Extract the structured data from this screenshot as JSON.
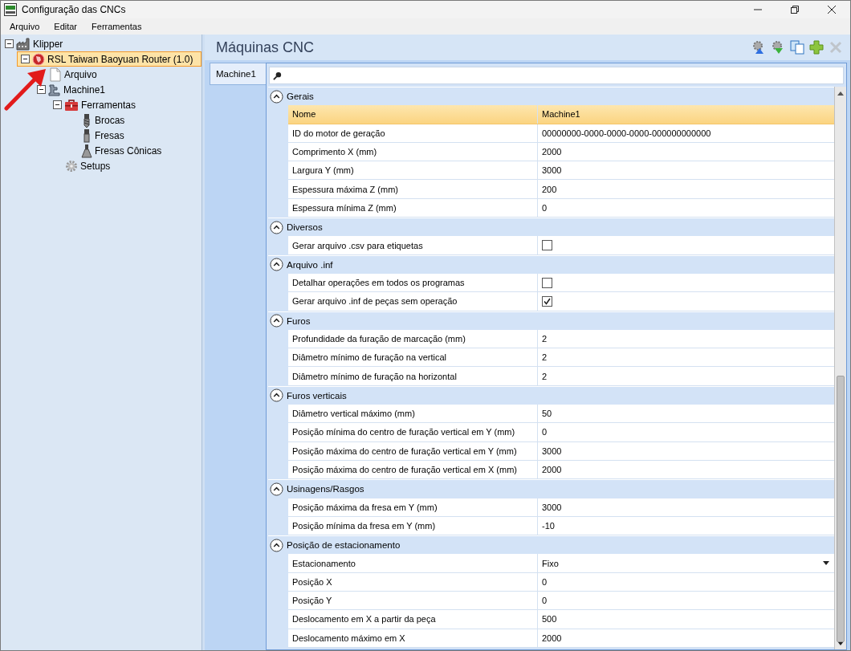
{
  "window": {
    "title": "Configuração das CNCs"
  },
  "menu": [
    {
      "label": "Arquivo"
    },
    {
      "label": "Editar"
    },
    {
      "label": "Ferramentas"
    }
  ],
  "tree": [
    {
      "label": "Klipper",
      "kind": "factory",
      "expanded": true,
      "selected": false,
      "children": [
        {
          "label": "RSL Taiwan Baoyuan Router (1.0)",
          "kind": "router",
          "expanded": true,
          "selected": true,
          "children": [
            {
              "label": "Arquivo",
              "kind": "file",
              "selected": false
            },
            {
              "label": "Machine1",
              "kind": "machine",
              "expanded": true,
              "selected": false,
              "children": [
                {
                  "label": "Ferramentas",
                  "kind": "toolbox",
                  "expanded": true,
                  "selected": false,
                  "children": [
                    {
                      "label": "Brocas",
                      "kind": "drill",
                      "selected": false
                    },
                    {
                      "label": "Fresas",
                      "kind": "mill",
                      "selected": false
                    },
                    {
                      "label": "Fresas Cônicas",
                      "kind": "cone",
                      "selected": false
                    }
                  ]
                },
                {
                  "label": "Setups",
                  "kind": "gear",
                  "selected": false
                }
              ]
            }
          ]
        }
      ]
    }
  ],
  "panel": {
    "title": "Máquinas CNC",
    "toolbar": [
      {
        "kind": "gear-up",
        "disabled": false
      },
      {
        "kind": "gear-down",
        "disabled": false
      },
      {
        "kind": "copy",
        "disabled": false
      },
      {
        "kind": "add",
        "disabled": false
      },
      {
        "kind": "delete",
        "disabled": true
      }
    ]
  },
  "tabs": [
    {
      "label": "Machine1",
      "selected": true
    }
  ],
  "sections": [
    {
      "title": "Gerais",
      "expanded": true,
      "rows": [
        {
          "name": "Nome",
          "value": "Machine1",
          "kind": "text",
          "selected": true
        },
        {
          "name": "ID do motor de geração",
          "value": "00000000-0000-0000-0000-000000000000",
          "kind": "text",
          "selected": false
        },
        {
          "name": "Comprimento X (mm)",
          "value": "2000",
          "kind": "text",
          "selected": false
        },
        {
          "name": "Largura Y (mm)",
          "value": "3000",
          "kind": "text",
          "selected": false
        },
        {
          "name": "Espessura máxima Z (mm)",
          "value": "200",
          "kind": "text",
          "selected": false
        },
        {
          "name": "Espessura mínima Z (mm)",
          "value": "0",
          "kind": "text",
          "selected": false
        }
      ]
    },
    {
      "title": "Diversos",
      "expanded": true,
      "rows": [
        {
          "name": "Gerar arquivo .csv para etiquetas",
          "kind": "checkbox",
          "checked": false,
          "selected": false
        }
      ]
    },
    {
      "title": "Arquivo .inf",
      "expanded": true,
      "rows": [
        {
          "name": "Detalhar operações em todos os programas",
          "kind": "checkbox",
          "checked": false,
          "selected": false
        },
        {
          "name": "Gerar arquivo .inf de peças sem operação",
          "kind": "checkbox",
          "checked": true,
          "selected": false
        }
      ]
    },
    {
      "title": "Furos",
      "expanded": true,
      "rows": [
        {
          "name": "Profundidade da furação de marcação (mm)",
          "value": "2",
          "kind": "text",
          "selected": false
        },
        {
          "name": "Diâmetro mínimo de furação na vertical",
          "value": "2",
          "kind": "text",
          "selected": false
        },
        {
          "name": "Diâmetro mínimo de furação na horizontal",
          "value": "2",
          "kind": "text",
          "selected": false
        }
      ]
    },
    {
      "title": "Furos verticais",
      "expanded": true,
      "rows": [
        {
          "name": "Diâmetro vertical máximo (mm)",
          "value": "50",
          "kind": "text",
          "selected": false
        },
        {
          "name": "Posição mínima do centro de furação vertical em Y (mm)",
          "value": "0",
          "kind": "text",
          "selected": false
        },
        {
          "name": "Posição máxima do centro de furação vertical em Y (mm)",
          "value": "3000",
          "kind": "text",
          "selected": false
        },
        {
          "name": "Posição máxima do centro de furação vertical em X (mm)",
          "value": "2000",
          "kind": "text",
          "selected": false
        }
      ]
    },
    {
      "title": "Usinagens/Rasgos",
      "expanded": true,
      "rows": [
        {
          "name": "Posição máxima da fresa em Y (mm)",
          "value": "3000",
          "kind": "text",
          "selected": false
        },
        {
          "name": "Posição mínima da fresa em Y (mm)",
          "value": "-10",
          "kind": "text",
          "selected": false
        }
      ]
    },
    {
      "title": "Posição de estacionamento",
      "expanded": true,
      "rows": [
        {
          "name": "Estacionamento",
          "value": "Fixo",
          "kind": "dropdown",
          "selected": false
        },
        {
          "name": "Posição X",
          "value": "0",
          "kind": "text",
          "selected": false
        },
        {
          "name": "Posição Y",
          "value": "0",
          "kind": "text",
          "selected": false
        },
        {
          "name": "Deslocamento em X a partir da peça",
          "value": "500",
          "kind": "text",
          "selected": false
        },
        {
          "name": "Deslocamento máximo em X",
          "value": "2000",
          "kind": "text",
          "selected": false
        }
      ]
    }
  ]
}
